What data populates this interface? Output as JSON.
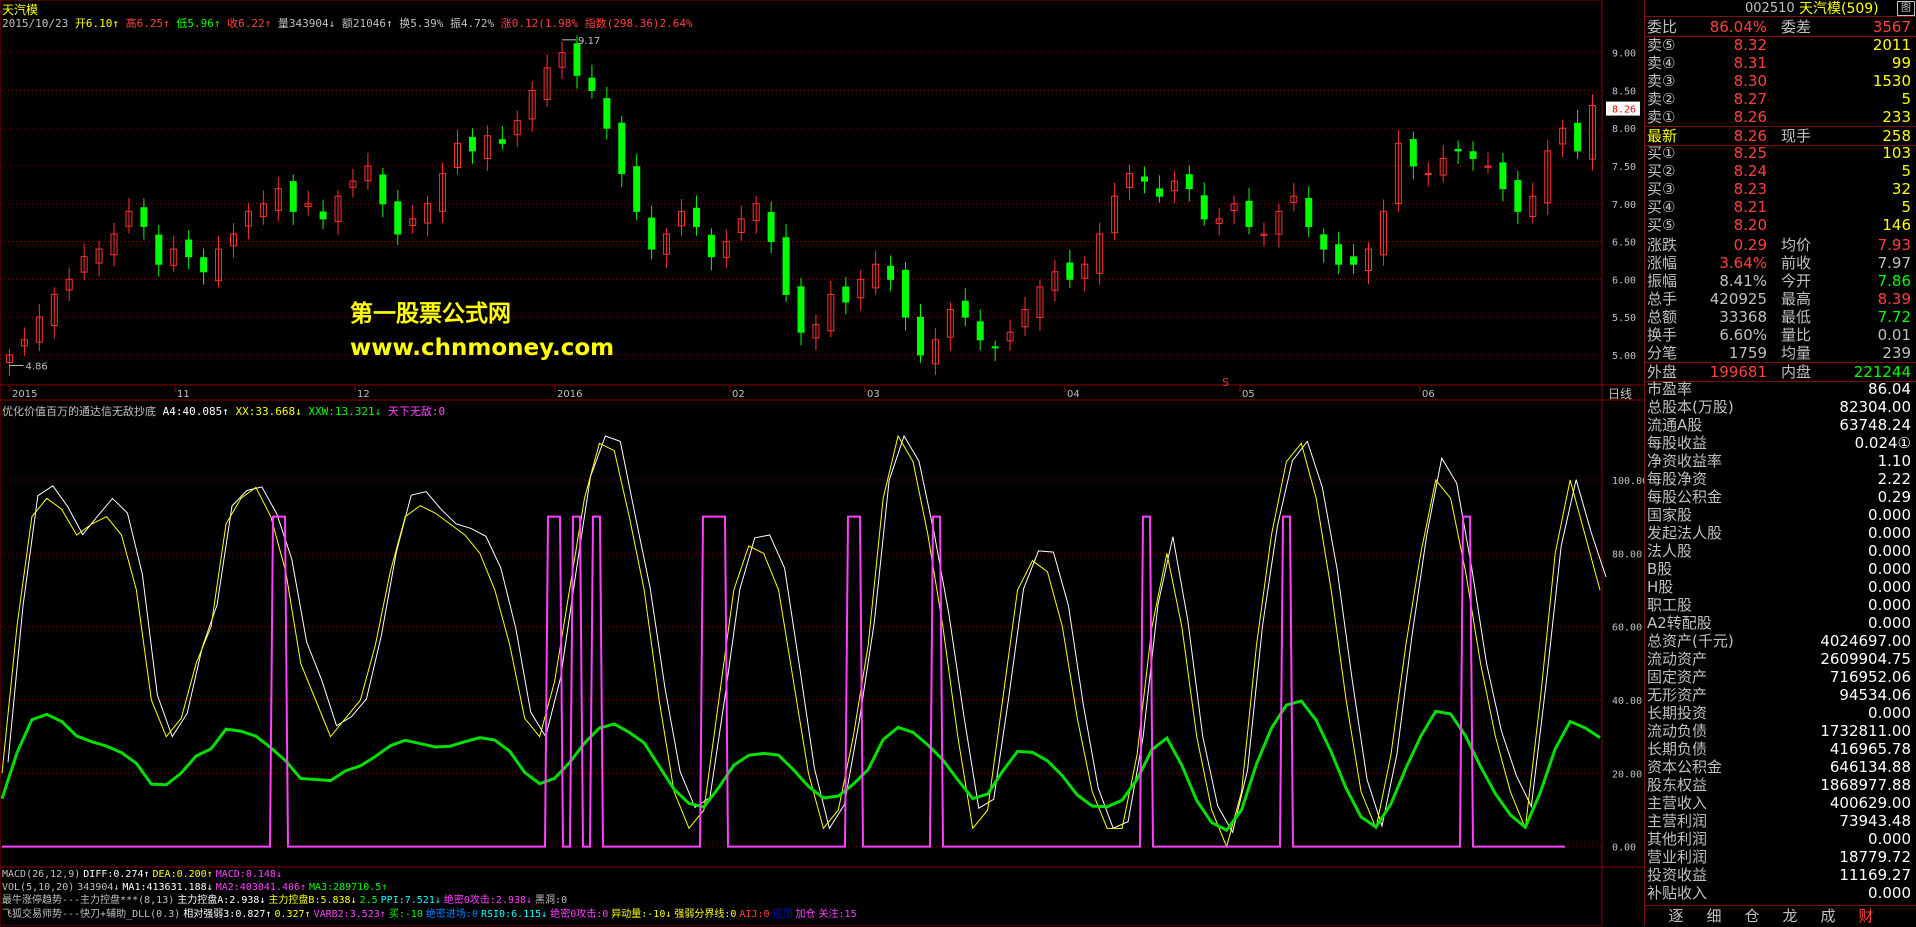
{
  "header": {
    "stock_name": "天汽模",
    "date": "2015/10/23",
    "open": "开6.10↑",
    "high": "高6.25↑",
    "low": "低5.96↑",
    "close": "收6.22↑",
    "volume": "量343904↓",
    "amount": "额21046↑",
    "turnover": "换5.39%",
    "amplitude": "振4.72%",
    "change": "涨0.12(1.98%",
    "index": "指数(298.36)2.64%"
  },
  "watermark": {
    "title": "第一股票公式网",
    "url": "www.chnmoney.com"
  },
  "price_labels": [
    "9.00",
    "8.50",
    "8.00",
    "7.50",
    "7.00",
    "6.50",
    "6.00",
    "5.50",
    "5.00"
  ],
  "current_price_tag": "8.26",
  "annotations": {
    "high_mark": "9.17",
    "low_mark": "4.86",
    "event_mark": "S"
  },
  "time_axis": [
    "2015",
    "11",
    "12",
    "2016",
    "02",
    "03",
    "04",
    "05",
    "06"
  ],
  "time_axis_right": "日线",
  "indicator_labels": [
    "100.00",
    "80.00",
    "60.00",
    "40.00",
    "20.00",
    "0.00"
  ],
  "indicator_title": {
    "name": "优化价值百万的通达信无敌抄底",
    "a4": "A4:40.085↑",
    "xx": "XX:33.668↓",
    "xxw": "XXW:13.321↓",
    "tx": "天下无敌:0"
  },
  "footer": {
    "macd": [
      "MACD(26,12,9)",
      "DIFF:0.274↑",
      "DEA:0.200↑",
      "MACD:0.148↓"
    ],
    "vol": [
      "VOL(5,10,20)",
      "343904↓",
      "MA1:413631.188↓",
      "MA2:403041.406↑",
      "MA3:289710.5↑"
    ],
    "line3": [
      "最牛涨停趋势---主力控盘***(8,13)",
      "主力控盘A:2.938↓",
      "主力控盘B:5.838↓",
      "2.5",
      "PPI:7.521↓",
      "绝密0攻击:2.938↓",
      "黑洞:0"
    ],
    "line4": [
      "飞狐交易师势---快刀+辅助_DLL(0.3)",
      "相对强弱3:0.827↑",
      "0.327↑",
      "VARB2:3.523↑",
      "买:-10",
      "绝密进场:0",
      "RSI0:6.115↓",
      "绝密0攻击:0",
      "异动量:-10↓",
      "强弱分界线:0",
      "AIJ:0",
      "逃顶",
      "加仓",
      "关注:15"
    ]
  },
  "sidebar": {
    "code": "002510",
    "name": "天汽模(509)",
    "icon_label": "图",
    "weibi": {
      "label": "委比",
      "value": "86.04%",
      "label2": "委差",
      "value2": "3567"
    },
    "sells": [
      {
        "label": "卖⑤",
        "price": "8.32",
        "vol": "2011"
      },
      {
        "label": "卖④",
        "price": "8.31",
        "vol": "99"
      },
      {
        "label": "卖③",
        "price": "8.30",
        "vol": "1530"
      },
      {
        "label": "卖②",
        "price": "8.27",
        "vol": "5"
      },
      {
        "label": "卖①",
        "price": "8.26",
        "vol": "233"
      }
    ],
    "latest": {
      "label": "最新",
      "price": "8.26",
      "label2": "现手",
      "vol": "258"
    },
    "buys": [
      {
        "label": "买①",
        "price": "8.25",
        "vol": "103"
      },
      {
        "label": "买②",
        "price": "8.24",
        "vol": "5"
      },
      {
        "label": "买③",
        "price": "8.23",
        "vol": "32"
      },
      {
        "label": "买④",
        "price": "8.21",
        "vol": "5"
      },
      {
        "label": "买⑤",
        "price": "8.20",
        "vol": "146"
      }
    ],
    "stats": [
      {
        "l1": "涨跌",
        "v1": "0.29",
        "l2": "均价",
        "v2": "7.93",
        "c1": "#ff4040",
        "c2": "#ff4040"
      },
      {
        "l1": "涨幅",
        "v1": "3.64%",
        "l2": "前收",
        "v2": "7.97",
        "c1": "#ff4040",
        "c2": "#c0c0c0"
      },
      {
        "l1": "振幅",
        "v1": "8.41%",
        "l2": "今开",
        "v2": "7.86",
        "c1": "#c0c0c0",
        "c2": "#00ff00"
      },
      {
        "l1": "总手",
        "v1": "420925",
        "l2": "最高",
        "v2": "8.39",
        "c1": "#c0c0c0",
        "c2": "#ff4040"
      },
      {
        "l1": "总额",
        "v1": "33368",
        "l2": "最低",
        "v2": "7.72",
        "c1": "#c0c0c0",
        "c2": "#00ff00"
      },
      {
        "l1": "换手",
        "v1": "6.60%",
        "l2": "量比",
        "v2": "0.01",
        "c1": "#c0c0c0",
        "c2": "#c0c0c0"
      },
      {
        "l1": "分笔",
        "v1": "1759",
        "l2": "均量",
        "v2": "239",
        "c1": "#c0c0c0",
        "c2": "#c0c0c0"
      }
    ],
    "outer": {
      "label": "外盘",
      "value": "199681",
      "label2": "内盘",
      "value2": "221244"
    },
    "fundamentals": [
      {
        "label": "市盈率",
        "value": "86.04"
      },
      {
        "label": "总股本(万股)",
        "value": "82304.00"
      },
      {
        "label": "流通A股",
        "value": "63748.24"
      },
      {
        "label": "每股收益",
        "value": "0.024①"
      },
      {
        "label": "净资收益率",
        "value": "1.10"
      },
      {
        "label": "每股净资",
        "value": "2.22"
      },
      {
        "label": "每股公积金",
        "value": "0.29"
      },
      {
        "label": "国家股",
        "value": "0.000"
      },
      {
        "label": "发起法人股",
        "value": "0.000"
      },
      {
        "label": "法人股",
        "value": "0.000"
      },
      {
        "label": "B股",
        "value": "0.000"
      },
      {
        "label": "H股",
        "value": "0.000"
      },
      {
        "label": "职工股",
        "value": "0.000"
      },
      {
        "label": "A2转配股",
        "value": "0.000"
      },
      {
        "label": "总资产(千元)",
        "value": "4024697.00"
      },
      {
        "label": "流动资产",
        "value": "2609904.75"
      },
      {
        "label": "固定资产",
        "value": "716952.06"
      },
      {
        "label": "无形资产",
        "value": "94534.06"
      },
      {
        "label": "长期投资",
        "value": "0.000"
      },
      {
        "label": "流动负债",
        "value": "1732811.00"
      },
      {
        "label": "长期负债",
        "value": "416965.78"
      },
      {
        "label": "资本公积金",
        "value": "646134.88"
      },
      {
        "label": "股东权益",
        "value": "1868977.88"
      },
      {
        "label": "主营收入",
        "value": "400629.00"
      },
      {
        "label": "主营利润",
        "value": "73943.48"
      },
      {
        "label": "其他利润",
        "value": "0.000"
      },
      {
        "label": "营业利润",
        "value": "18779.72"
      },
      {
        "label": "投资收益",
        "value": "11169.27"
      },
      {
        "label": "补贴收入",
        "value": "0.000"
      }
    ],
    "tabs": [
      "逐",
      "细",
      "仓",
      "龙",
      "成",
      "财"
    ]
  },
  "colors": {
    "up": "#ff3030",
    "down": "#00ff00",
    "white_line": "#ffffff",
    "yellow_line": "#ffff00",
    "green_line": "#00e000",
    "magenta_line": "#ff40ff",
    "grid": "#8b0000"
  },
  "chart_data": {
    "type": "candlestick",
    "y_range_price": [
      4.8,
      9.3
    ],
    "y_range_indicator": [
      -5,
      115
    ],
    "price_close_series": [
      5.0,
      5.2,
      5.5,
      5.8,
      6.0,
      6.3,
      6.4,
      6.6,
      6.9,
      6.7,
      6.2,
      6.4,
      6.3,
      6.1,
      6.4,
      6.6,
      6.9,
      7.0,
      7.2,
      6.9,
      7.0,
      6.8,
      7.1,
      7.3,
      7.5,
      7.0,
      6.6,
      6.8,
      7.0,
      7.4,
      7.8,
      7.7,
      7.9,
      7.8,
      8.1,
      8.5,
      8.8,
      9.0,
      8.7,
      8.5,
      8.0,
      7.4,
      6.9,
      6.4,
      6.6,
      6.9,
      6.7,
      6.3,
      6.5,
      6.8,
      7.0,
      6.5,
      5.8,
      5.3,
      5.4,
      5.8,
      5.7,
      6.0,
      6.2,
      6.0,
      5.5,
      5.0,
      5.2,
      5.6,
      5.5,
      5.2,
      5.1,
      5.3,
      5.6,
      5.9,
      6.1,
      6.0,
      6.2,
      6.6,
      7.1,
      7.4,
      7.3,
      7.1,
      7.3,
      7.2,
      6.8,
      6.8,
      7.0,
      6.7,
      6.6,
      6.9,
      7.1,
      6.7,
      6.4,
      6.2,
      6.2,
      6.4,
      6.9,
      7.8,
      7.5,
      7.4,
      7.6,
      7.7,
      7.6,
      7.5,
      7.2,
      6.9,
      7.1,
      7.7,
      8.0,
      7.7,
      8.3
    ],
    "indicator_yellow_series": [
      20,
      60,
      90,
      95,
      92,
      85,
      88,
      90,
      85,
      70,
      40,
      30,
      35,
      50,
      60,
      88,
      95,
      98,
      90,
      75,
      50,
      40,
      30,
      35,
      40,
      55,
      75,
      90,
      93,
      91,
      88,
      85,
      80,
      70,
      55,
      35,
      30,
      45,
      70,
      95,
      110,
      108,
      90,
      70,
      40,
      15,
      5,
      10,
      40,
      70,
      82,
      80,
      70,
      45,
      20,
      5,
      10,
      30,
      55,
      95,
      112,
      105,
      85,
      60,
      30,
      5,
      10,
      40,
      70,
      78,
      75,
      60,
      35,
      15,
      5,
      5,
      25,
      60,
      80,
      60,
      30,
      10,
      0,
      15,
      55,
      85,
      105,
      110,
      95,
      70,
      40,
      15,
      5,
      25,
      55,
      80,
      100,
      95,
      75,
      50,
      30,
      15,
      5,
      40,
      80,
      100,
      85,
      70
    ]
  }
}
